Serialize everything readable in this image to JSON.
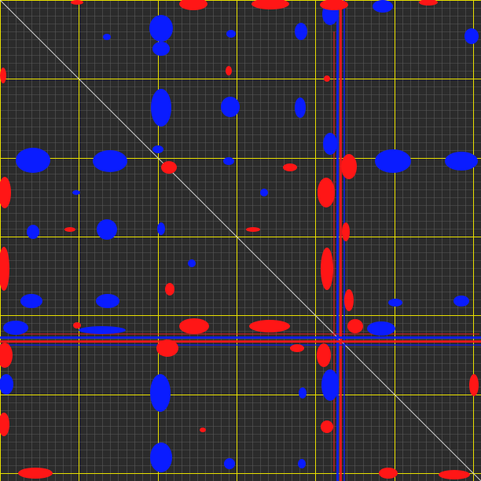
{
  "colors": {
    "background": "#2b2b2b",
    "minor_grid": "#5a5a5a",
    "major_grid": "#e8e000",
    "diagonal": "#cfcfcf",
    "positive_peak": "#0a1cff",
    "negative_peak": "#ff1616"
  },
  "grid": {
    "minor_divisions": 61,
    "major_every": 10,
    "diagonal": true
  }
}
